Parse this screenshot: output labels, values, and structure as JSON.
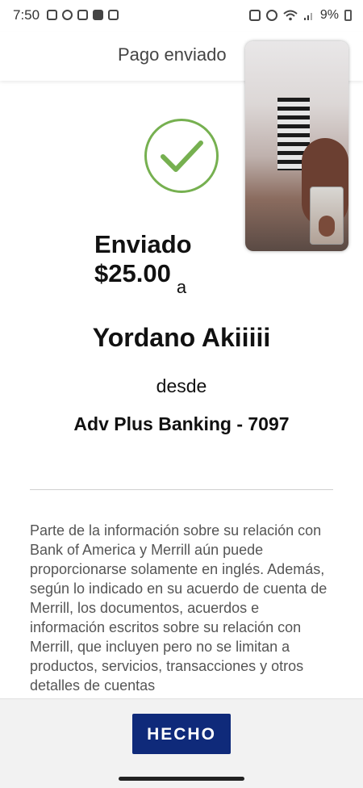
{
  "status_bar": {
    "time": "7:50",
    "battery": "9%",
    "left_icons": [
      "video-icon",
      "messenger-icon",
      "instagram-icon",
      "app-grid-icon",
      "video-call-icon"
    ],
    "right_icons": [
      "nfc-icon",
      "alarm-icon",
      "wifi-icon",
      "signal-icon"
    ]
  },
  "header": {
    "title": "Pago enviado"
  },
  "confirmation": {
    "amount_label": "Enviado $25.00",
    "to_label": "a",
    "recipient": "Yordano Akiiiii",
    "from_label": "desde",
    "account": "Adv Plus Banking - 7097"
  },
  "disclaimer": {
    "text": "Parte de la información sobre su relación con Bank of America y Merrill aún puede proporcionarse solamente en inglés. Además, según lo indicado en su acuerdo de cuenta de Merrill, los documentos, acuerdos e información escritos sobre su relación con Merrill, que incluyen pero no se limitan a productos, servicios, transacciones y otros detalles de cuentas"
  },
  "actions": {
    "done_label": "HECHO"
  },
  "colors": {
    "check_green": "#76b050",
    "button_blue": "#0f2a7a"
  }
}
